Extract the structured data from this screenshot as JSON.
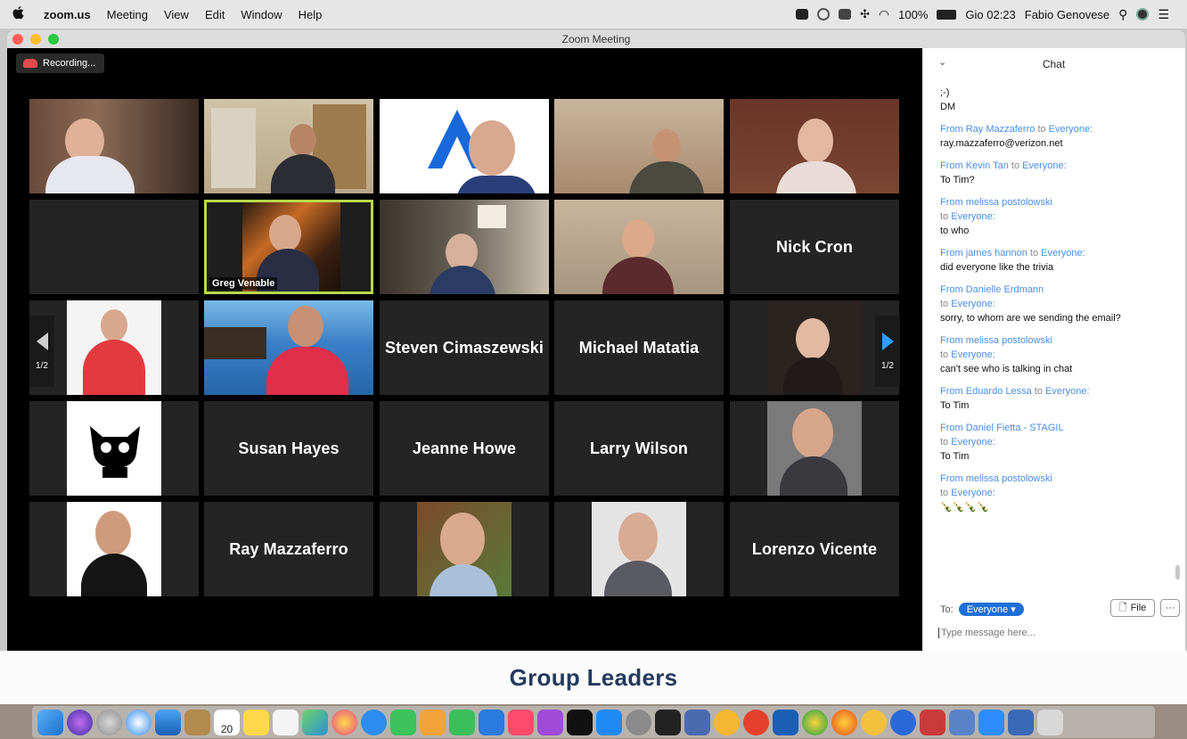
{
  "menubar": {
    "apple": "",
    "items": [
      "zoom.us",
      "Meeting",
      "View",
      "Edit",
      "Window",
      "Help"
    ],
    "battery": "100%",
    "clock": "Gio 02:23",
    "user": "Fabio Genovese"
  },
  "window": {
    "title": "Zoom Meeting",
    "recording_label": "Recording..."
  },
  "gallery": {
    "page_left": "1/2",
    "page_right": "1/2",
    "active_speaker_label": "Greg Venable",
    "tiles_names": {
      "nick": "Nick Cron",
      "steven": "Steven Cimaszewski",
      "michael": "Michael Matatia",
      "susan": "Susan Hayes",
      "jeanne": "Jeanne Howe",
      "larry": "Larry Wilson",
      "ray": "Ray Mazzaferro",
      "lorenzo": "Lorenzo Vicente"
    }
  },
  "chat": {
    "title": "Chat",
    "first_lines": [
      ";-)",
      "DM"
    ],
    "messages": [
      {
        "from": "Ray Mazzaferro",
        "to": "Everyone:",
        "text": "ray.mazzaferro@verizon.net",
        "wrap": false
      },
      {
        "from": "Kevin Tan",
        "to": "Everyone:",
        "text": "To Tim?",
        "wrap": false
      },
      {
        "from": "melissa postolowski",
        "to": "Everyone:",
        "text": "to who",
        "wrap": true
      },
      {
        "from": "james hannon",
        "to": "Everyone:",
        "text": "did everyone like the trivia",
        "wrap": false
      },
      {
        "from": "Danielle Erdmann",
        "to": "Everyone:",
        "text": "sorry, to whom are we sending the email?",
        "wrap": true
      },
      {
        "from": "melissa postolowski",
        "to": "Everyone:",
        "text": "can't see who is talking in chat",
        "wrap": true
      },
      {
        "from": "Eduardo Lessa",
        "to": "Everyone:",
        "text": "To Tim",
        "wrap": false
      },
      {
        "from": "Daniel Fietta - STAGIL",
        "to": "Everyone:",
        "text": "To Tim",
        "wrap": true
      },
      {
        "from": "melissa postolowski",
        "to": "Everyone:",
        "text": "🍾🍾🍾🍾",
        "wrap": true
      }
    ],
    "from_word": "From",
    "to_word": "to",
    "to_label": "To:",
    "to_value": "Everyone",
    "file_label": "File",
    "more_label": "···",
    "input_placeholder": "Type message here..."
  },
  "banner": {
    "text": "Group Leaders"
  },
  "dock": {
    "calendar_day": "20"
  }
}
